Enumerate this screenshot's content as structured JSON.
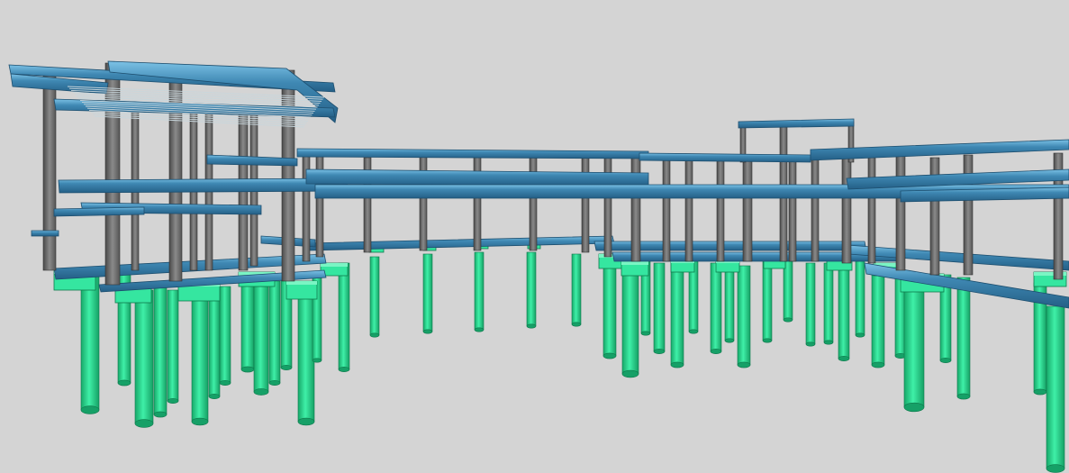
{
  "viewport": {
    "background": "#d4d4d4"
  },
  "model": {
    "piles": {
      "icon": "cylinder-pile-icon",
      "color": "#2fe89a",
      "shade": "#17a869"
    },
    "pile_caps": {
      "color": "#35e6a0"
    },
    "beams": {
      "icon": "structural-beam-icon",
      "color": "#3f88b3",
      "top": "#6fb6dc",
      "shade": "#22567a"
    },
    "columns": {
      "icon": "structural-column-icon",
      "color": "#7a7a7a",
      "shade": "#4a4a4a"
    },
    "roof_grid": {
      "icon": "roof-grating-icon",
      "color": "#c8d6dc"
    }
  }
}
